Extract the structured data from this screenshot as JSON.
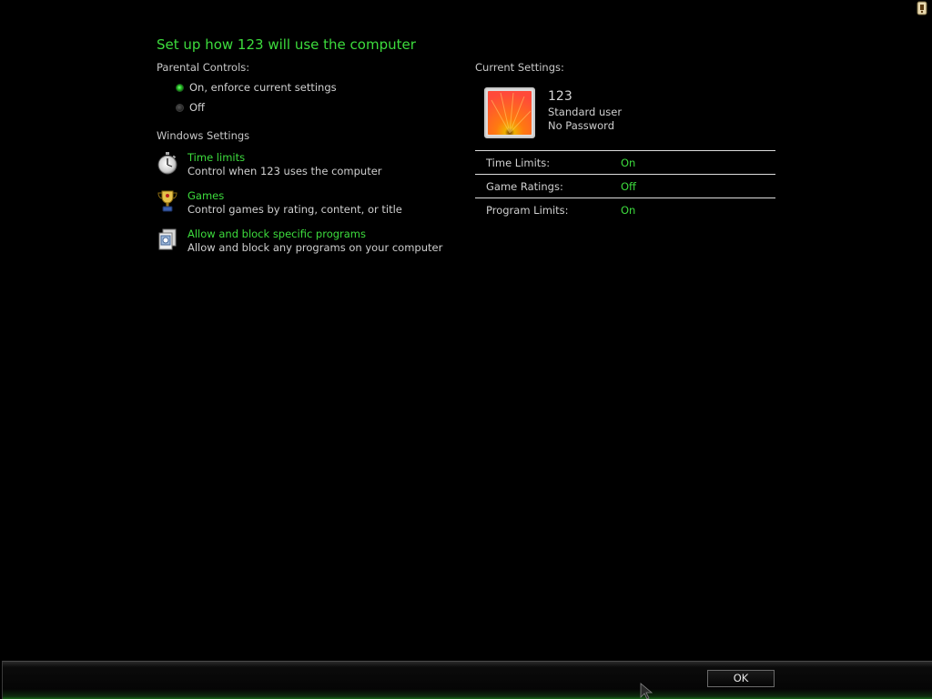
{
  "header": {
    "title": "Set up how 123 will use the computer"
  },
  "parental_controls": {
    "label": "Parental Controls:",
    "options": [
      {
        "label": "On, enforce current settings",
        "selected": true
      },
      {
        "label": "Off",
        "selected": false
      }
    ]
  },
  "windows_settings": {
    "label": "Windows Settings",
    "items": [
      {
        "icon": "stopwatch-icon",
        "title": "Time limits",
        "description": "Control when 123 uses the computer"
      },
      {
        "icon": "trophy-icon",
        "title": "Games",
        "description": "Control games by rating, content, or title"
      },
      {
        "icon": "programs-icon",
        "title": "Allow and block specific programs",
        "description": "Allow and block any programs on your computer"
      }
    ]
  },
  "current_settings": {
    "label": "Current Settings:",
    "user": {
      "name": "123",
      "type": "Standard user",
      "password": "No Password"
    },
    "rows": [
      {
        "key": "Time Limits:",
        "value": "On"
      },
      {
        "key": "Game Ratings:",
        "value": "Off"
      },
      {
        "key": "Program Limits:",
        "value": "On"
      }
    ]
  },
  "footer": {
    "ok_label": "OK"
  },
  "colors": {
    "accent": "#3ddc3d",
    "background": "#000000",
    "text": "#cfcfcf"
  }
}
